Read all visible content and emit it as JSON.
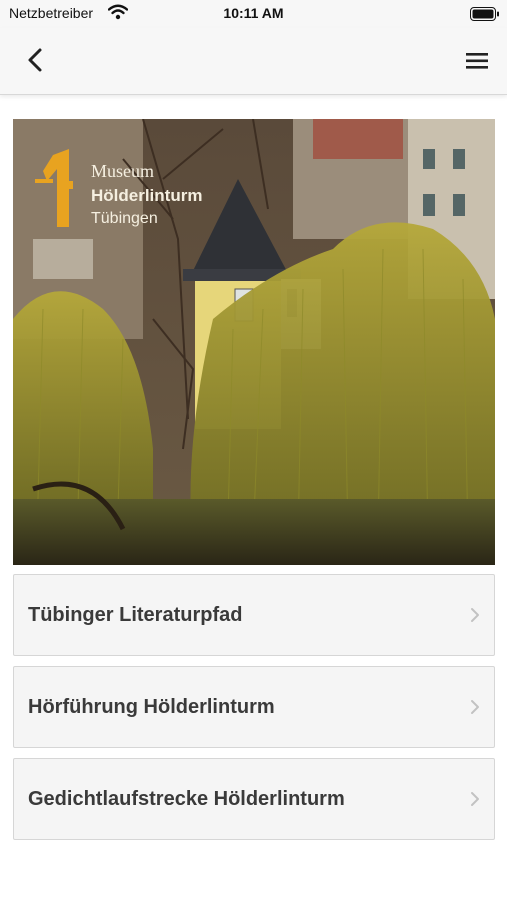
{
  "status_bar": {
    "carrier": "Netzbetreiber",
    "time": "10:11 AM"
  },
  "nav": {
    "back_icon": "chevron-left-icon",
    "menu_icon": "hamburger-menu-icon"
  },
  "hero": {
    "logo_line1": "Museum",
    "logo_line2": "Hölderlinturm",
    "logo_line3": "Tübingen",
    "logo_color": "#e8a320"
  },
  "menu_items": [
    {
      "label": "Tübinger Literaturpfad"
    },
    {
      "label": "Hörführung Hölderlinturm"
    },
    {
      "label": "Gedichtlaufstrecke Hölderlinturm"
    }
  ],
  "colors": {
    "bar_background": "#f7f7f7",
    "item_background": "#f5f5f5",
    "item_text": "#3a3a3a",
    "chevron": "#c2c2c2"
  }
}
